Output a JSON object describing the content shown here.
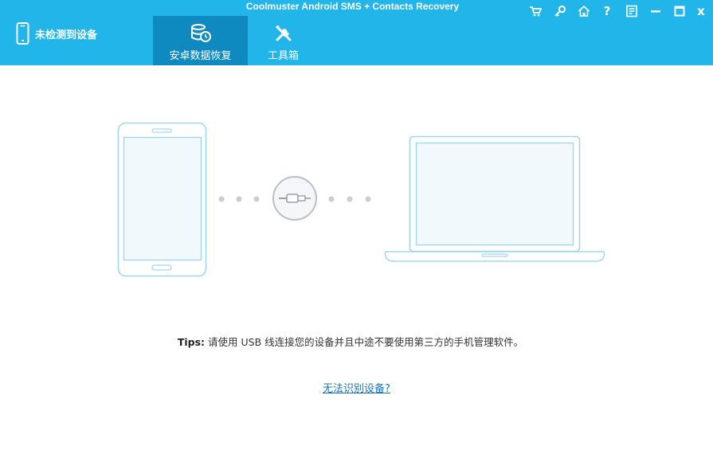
{
  "window": {
    "title": "Coolmuster Android SMS + Contacts Recovery"
  },
  "device_status": {
    "label": "未检测到设备",
    "icon": "phone-icon"
  },
  "tabs": [
    {
      "label": "安卓数据恢复",
      "icon": "database-restore-icon",
      "active": true
    },
    {
      "label": "工具箱",
      "icon": "tools-icon",
      "active": false
    }
  ],
  "window_controls": {
    "cart_icon": "cart-icon",
    "key_icon": "key-icon",
    "home_icon": "home-icon",
    "help_label": "?",
    "feedback_icon": "feedback-icon",
    "minimize_icon": "minimize-icon",
    "maximize_icon": "maximize-icon",
    "close_label": "x"
  },
  "main": {
    "tips_label": "Tips:",
    "tips_text": " 请使用 USB 线连接您的设备并且中途不要使用第三方的手机管理软件。",
    "help_link": "无法识别设备?"
  },
  "colors": {
    "header_bg": "#21b5ea",
    "active_tab_bg": "#0f8ac1",
    "illustration_stroke": "#a3d6ee",
    "illustration_fill": "#f2f9fd",
    "link": "#1a73b8"
  }
}
